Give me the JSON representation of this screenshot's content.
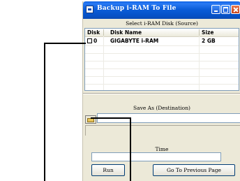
{
  "window": {
    "title": "Backup i-RAM To File"
  },
  "source": {
    "caption": "Select i-RAM Disk (Source)",
    "columns": [
      "Disk",
      "Disk Name",
      "Size"
    ],
    "rows": [
      {
        "disk": "0",
        "name": "GIGABYTE i-RAM",
        "size": "2 GB"
      }
    ]
  },
  "destination": {
    "caption": "Save As (Destination)",
    "path_value": ""
  },
  "time": {
    "caption": "Time",
    "value": ""
  },
  "buttons": {
    "run": "Run",
    "previous": "Go To Previous Page"
  },
  "icons": {
    "app": "disk-app-icon",
    "minimize": "minimize-icon",
    "maximize": "maximize-icon",
    "close": "close-icon",
    "folder": "folder-icon",
    "checkbox": "checkbox-icon"
  },
  "colors": {
    "titlebar": "#0a5fe4",
    "window_bg": "#ece9d8",
    "close_button": "#c6411a"
  }
}
